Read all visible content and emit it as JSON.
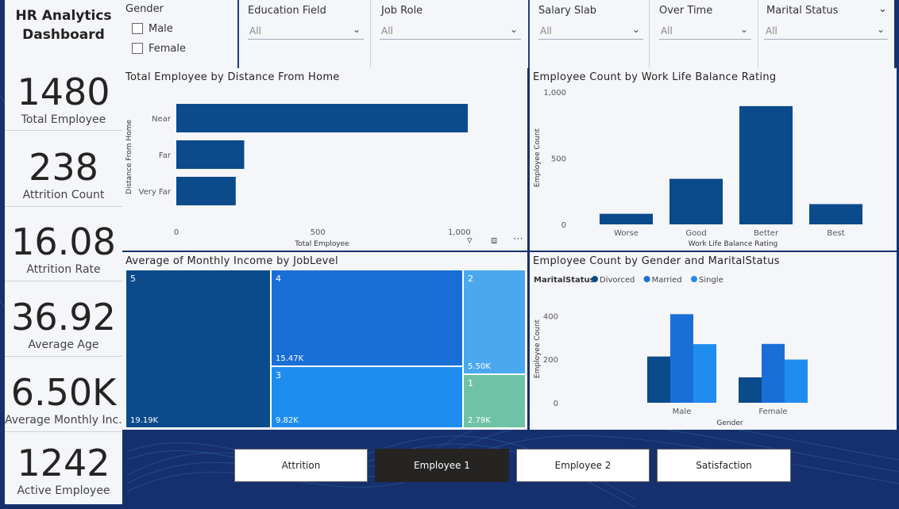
{
  "dashboard": {
    "title_line1": "HR Analytics",
    "title_line2": "Dashboard"
  },
  "kpis": [
    {
      "value": "1480",
      "label": "Total Employee"
    },
    {
      "value": "238",
      "label": "Attrition Count"
    },
    {
      "value": "16.08",
      "label": "Attrition Rate"
    },
    {
      "value": "36.92",
      "label": "Average Age"
    },
    {
      "value": "6.50K",
      "label": "Average Monthly Inc..."
    },
    {
      "value": "1242",
      "label": "Active Employee"
    }
  ],
  "slicers": {
    "gender": {
      "label": "Gender",
      "options": [
        "Male",
        "Female"
      ]
    },
    "dropdowns": [
      {
        "label": "Education Field",
        "value": "All"
      },
      {
        "label": "Job Role",
        "value": "All"
      },
      {
        "label": "Salary Slab",
        "value": "All"
      },
      {
        "label": "Over Time",
        "value": "All"
      },
      {
        "label": "Marital Status",
        "value": "All"
      }
    ]
  },
  "colors": {
    "dark": "#0b4a8b",
    "mid": "#1a6fd6",
    "light": "#1f8df0",
    "sky": "#4aa8ef",
    "green": "#6fc2a6"
  },
  "chart_data": [
    {
      "type": "bar",
      "orientation": "horizontal",
      "title": "Total Employee by Distance From Home",
      "categories": [
        "Near",
        "Far",
        "Very Far"
      ],
      "values": [
        1030,
        240,
        210
      ],
      "xlabel": "Total Employee",
      "ylabel": "Distance From Home",
      "xticks": [
        "0",
        "500",
        "1,000"
      ],
      "xlim": [
        0,
        1030
      ]
    },
    {
      "type": "bar",
      "title": "Employee Count by Work Life Balance Rating",
      "categories": [
        "Worse",
        "Good",
        "Better",
        "Best"
      ],
      "values": [
        80,
        344,
        893,
        153
      ],
      "xlabel": "Work Life Balance Rating",
      "ylabel": "Employee Count",
      "yticks": [
        "0",
        "500",
        "1,000"
      ],
      "ylim": [
        0,
        1000
      ]
    },
    {
      "type": "treemap",
      "title": "Average of Monthly Income by JobLevel",
      "items": [
        {
          "label": "5",
          "value_label": "19.19K",
          "value": 19.19
        },
        {
          "label": "4",
          "value_label": "15.47K",
          "value": 15.47
        },
        {
          "label": "3",
          "value_label": "9.82K",
          "value": 9.82
        },
        {
          "label": "2",
          "value_label": "5.50K",
          "value": 5.5
        },
        {
          "label": "1",
          "value_label": "2.79K",
          "value": 2.79
        }
      ]
    },
    {
      "type": "bar",
      "title": "Employee Count by Gender and MaritalStatus",
      "legend_title": "MaritalStatus",
      "categories": [
        "Male",
        "Female"
      ],
      "series": [
        {
          "name": "Divorced",
          "values": [
            213,
            117
          ]
        },
        {
          "name": "Married",
          "values": [
            408,
            271
          ]
        },
        {
          "name": "Single",
          "values": [
            270,
            199
          ]
        }
      ],
      "xlabel": "Gender",
      "ylabel": "Employee Count",
      "yticks": [
        "0",
        "200",
        "400"
      ],
      "ylim": [
        0,
        420
      ]
    }
  ],
  "nav": [
    {
      "label": "Attrition",
      "active": false
    },
    {
      "label": "Employee 1",
      "active": true
    },
    {
      "label": "Employee 2",
      "active": false
    },
    {
      "label": "Satisfaction",
      "active": false
    }
  ]
}
